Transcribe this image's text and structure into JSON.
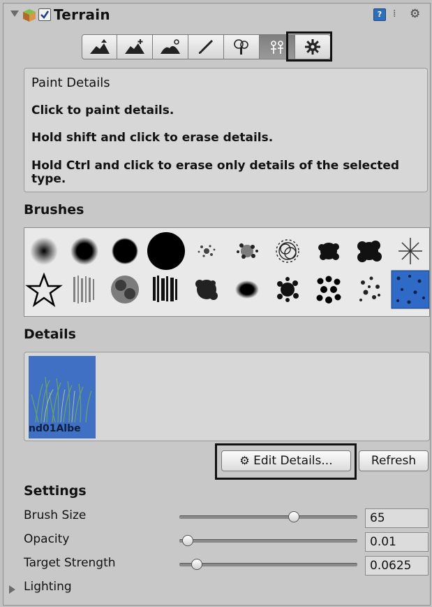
{
  "component": {
    "title": "Terrain",
    "enabled": true,
    "help_icon": "help-icon",
    "menu_icons": [
      "layout-icon",
      "gear-icon"
    ]
  },
  "toolbar": {
    "tools": [
      {
        "name": "raise-lower-terrain",
        "icon": "mountain-up-icon"
      },
      {
        "name": "paint-height",
        "icon": "mountain-plus-icon"
      },
      {
        "name": "smooth-height",
        "icon": "mountain-smooth-icon"
      },
      {
        "name": "paint-texture",
        "icon": "paintbrush-icon"
      },
      {
        "name": "place-trees",
        "icon": "tree-icon"
      },
      {
        "name": "paint-details",
        "icon": "flower-icon",
        "active": true
      },
      {
        "name": "terrain-settings",
        "icon": "gear-icon"
      }
    ]
  },
  "help": {
    "title": "Paint Details",
    "lines": [
      "Click to paint details.",
      "Hold shift and click to erase details.",
      "Hold Ctrl and click to erase only details of the selected type."
    ]
  },
  "brushes": {
    "label": "Brushes",
    "selected_index": 19,
    "count": 20
  },
  "details": {
    "label": "Details",
    "items": [
      {
        "label": "nd01Albe",
        "icon": "grass-texture-thumbnail"
      }
    ]
  },
  "buttons": {
    "edit_details": "Edit Details...",
    "refresh": "Refresh"
  },
  "settings": {
    "label": "Settings",
    "brush_size": {
      "label": "Brush Size",
      "value": "65",
      "fraction": 0.65
    },
    "opacity": {
      "label": "Opacity",
      "value": "0.01",
      "fraction": 0.01
    },
    "target_strength": {
      "label": "Target Strength",
      "value": "0.0625",
      "fraction": 0.0625
    }
  },
  "lighting": {
    "label": "Lighting"
  }
}
